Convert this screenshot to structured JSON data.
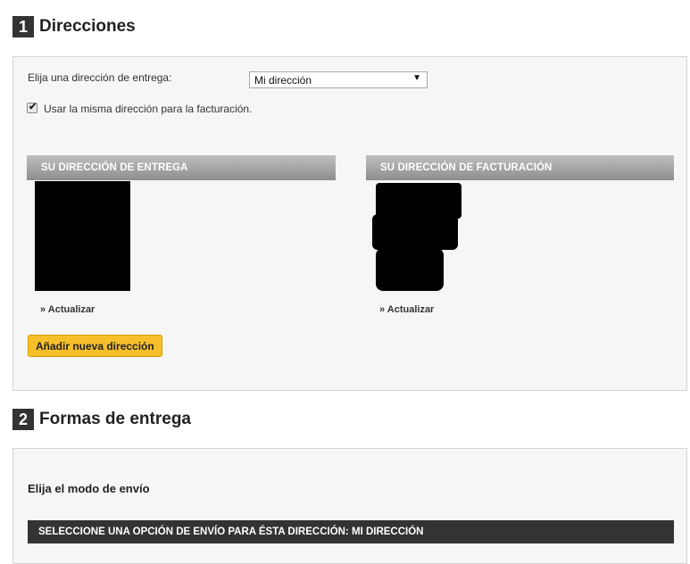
{
  "step1": {
    "number": "1",
    "title": "Direcciones",
    "delivery_select_label": "Elija una dirección de entrega:",
    "delivery_select_value": "Mi dirección",
    "same_billing_label": "Usar la misma dirección para la facturación.",
    "same_billing_checked": true,
    "delivery_address_header": "SU DIRECCIÓN DE ENTREGA",
    "billing_address_header": "SU DIRECCIÓN DE FACTURACIÓN",
    "update_link": "» Actualizar",
    "add_address_button": "Añadir nueva dirección"
  },
  "step2": {
    "number": "2",
    "title": "Formas de entrega",
    "shipping_mode_label": "Elija el modo de envío",
    "shipping_option_header": "SELECCIONE UNA OPCIÓN DE ENVÍO PARA ÉSTA DIRECCIÓN: MI DIRECCIÓN"
  },
  "colors": {
    "step_badge": "#333333",
    "button_accent": "#f7c02b",
    "panel_bg": "#f6f6f6"
  }
}
